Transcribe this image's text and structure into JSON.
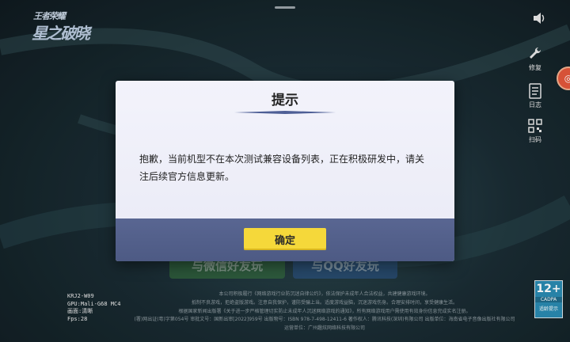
{
  "logo": {
    "top_text": "王者荣耀",
    "main_text": "星之破晓"
  },
  "side_buttons": {
    "speaker_icon": "speaker-icon",
    "repair_label": "修复",
    "log_label": "日志",
    "scan_label": "扫码"
  },
  "background_buttons": {
    "wechat_label": "与微信好友玩",
    "qq_label": "与QQ好友玩"
  },
  "device_info": {
    "model": "KRJ2-W09",
    "gpu": "GPU:Mali-G68 MC4",
    "quality": "画面:清晰",
    "fps": "Fps:28"
  },
  "legal": {
    "line1": "本公司积极履行《网络游戏行业防沉迷自律公约》，依法保护未成年人合法权益，共建健康游戏环境。",
    "line2": "抵制不良游戏，拒绝盗版游戏。注意自我保护，谨防受骗上当。适度游戏益脑，沉迷游戏伤身。合理安排时间，享受健康生活。",
    "line3": "根据国家新闻出版署《关于进一步严格管理切实防止未成年人沉迷网络游戏的通知》，所有网络游戏用户需使用有效身份信息完成实名注册。",
    "line4": "(署)网出证(粤)字第054号 审批文号：国新出审[2022]959号 出版物号：ISBN 978-7-498-12411-6 著作权人：腾讯科技(深圳)有限公司 出版单位：海南省电子音像出版社有限公司",
    "line5": "运营单位：广州趣炫网络科技有限公司"
  },
  "age_badge": {
    "rating": "12+",
    "org": "CADPA",
    "tip": "适龄提示"
  },
  "dialog": {
    "title": "提示",
    "message": "抱歉，当前机型不在本次测试兼容设备列表，正在积极研发中，请关注后续官方信息更新。",
    "confirm_label": "确定"
  },
  "colors": {
    "dialog_bg": "#f3f3fb",
    "dialog_footer": "#596692",
    "confirm_button": "#f5d83a",
    "title_underline": "#4e5f96"
  }
}
